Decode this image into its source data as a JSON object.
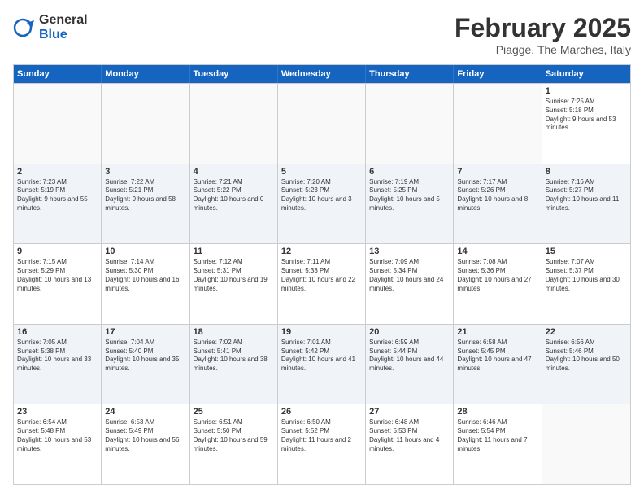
{
  "header": {
    "logo_general": "General",
    "logo_blue": "Blue",
    "title": "February 2025",
    "location": "Piagge, The Marches, Italy"
  },
  "days_of_week": [
    "Sunday",
    "Monday",
    "Tuesday",
    "Wednesday",
    "Thursday",
    "Friday",
    "Saturday"
  ],
  "weeks": [
    [
      {
        "day": "",
        "info": ""
      },
      {
        "day": "",
        "info": ""
      },
      {
        "day": "",
        "info": ""
      },
      {
        "day": "",
        "info": ""
      },
      {
        "day": "",
        "info": ""
      },
      {
        "day": "",
        "info": ""
      },
      {
        "day": "1",
        "info": "Sunrise: 7:25 AM\nSunset: 5:18 PM\nDaylight: 9 hours and 53 minutes."
      }
    ],
    [
      {
        "day": "2",
        "info": "Sunrise: 7:23 AM\nSunset: 5:19 PM\nDaylight: 9 hours and 55 minutes."
      },
      {
        "day": "3",
        "info": "Sunrise: 7:22 AM\nSunset: 5:21 PM\nDaylight: 9 hours and 58 minutes."
      },
      {
        "day": "4",
        "info": "Sunrise: 7:21 AM\nSunset: 5:22 PM\nDaylight: 10 hours and 0 minutes."
      },
      {
        "day": "5",
        "info": "Sunrise: 7:20 AM\nSunset: 5:23 PM\nDaylight: 10 hours and 3 minutes."
      },
      {
        "day": "6",
        "info": "Sunrise: 7:19 AM\nSunset: 5:25 PM\nDaylight: 10 hours and 5 minutes."
      },
      {
        "day": "7",
        "info": "Sunrise: 7:17 AM\nSunset: 5:26 PM\nDaylight: 10 hours and 8 minutes."
      },
      {
        "day": "8",
        "info": "Sunrise: 7:16 AM\nSunset: 5:27 PM\nDaylight: 10 hours and 11 minutes."
      }
    ],
    [
      {
        "day": "9",
        "info": "Sunrise: 7:15 AM\nSunset: 5:29 PM\nDaylight: 10 hours and 13 minutes."
      },
      {
        "day": "10",
        "info": "Sunrise: 7:14 AM\nSunset: 5:30 PM\nDaylight: 10 hours and 16 minutes."
      },
      {
        "day": "11",
        "info": "Sunrise: 7:12 AM\nSunset: 5:31 PM\nDaylight: 10 hours and 19 minutes."
      },
      {
        "day": "12",
        "info": "Sunrise: 7:11 AM\nSunset: 5:33 PM\nDaylight: 10 hours and 22 minutes."
      },
      {
        "day": "13",
        "info": "Sunrise: 7:09 AM\nSunset: 5:34 PM\nDaylight: 10 hours and 24 minutes."
      },
      {
        "day": "14",
        "info": "Sunrise: 7:08 AM\nSunset: 5:36 PM\nDaylight: 10 hours and 27 minutes."
      },
      {
        "day": "15",
        "info": "Sunrise: 7:07 AM\nSunset: 5:37 PM\nDaylight: 10 hours and 30 minutes."
      }
    ],
    [
      {
        "day": "16",
        "info": "Sunrise: 7:05 AM\nSunset: 5:38 PM\nDaylight: 10 hours and 33 minutes."
      },
      {
        "day": "17",
        "info": "Sunrise: 7:04 AM\nSunset: 5:40 PM\nDaylight: 10 hours and 35 minutes."
      },
      {
        "day": "18",
        "info": "Sunrise: 7:02 AM\nSunset: 5:41 PM\nDaylight: 10 hours and 38 minutes."
      },
      {
        "day": "19",
        "info": "Sunrise: 7:01 AM\nSunset: 5:42 PM\nDaylight: 10 hours and 41 minutes."
      },
      {
        "day": "20",
        "info": "Sunrise: 6:59 AM\nSunset: 5:44 PM\nDaylight: 10 hours and 44 minutes."
      },
      {
        "day": "21",
        "info": "Sunrise: 6:58 AM\nSunset: 5:45 PM\nDaylight: 10 hours and 47 minutes."
      },
      {
        "day": "22",
        "info": "Sunrise: 6:56 AM\nSunset: 5:46 PM\nDaylight: 10 hours and 50 minutes."
      }
    ],
    [
      {
        "day": "23",
        "info": "Sunrise: 6:54 AM\nSunset: 5:48 PM\nDaylight: 10 hours and 53 minutes."
      },
      {
        "day": "24",
        "info": "Sunrise: 6:53 AM\nSunset: 5:49 PM\nDaylight: 10 hours and 56 minutes."
      },
      {
        "day": "25",
        "info": "Sunrise: 6:51 AM\nSunset: 5:50 PM\nDaylight: 10 hours and 59 minutes."
      },
      {
        "day": "26",
        "info": "Sunrise: 6:50 AM\nSunset: 5:52 PM\nDaylight: 11 hours and 2 minutes."
      },
      {
        "day": "27",
        "info": "Sunrise: 6:48 AM\nSunset: 5:53 PM\nDaylight: 11 hours and 4 minutes."
      },
      {
        "day": "28",
        "info": "Sunrise: 6:46 AM\nSunset: 5:54 PM\nDaylight: 11 hours and 7 minutes."
      },
      {
        "day": "",
        "info": ""
      }
    ]
  ]
}
